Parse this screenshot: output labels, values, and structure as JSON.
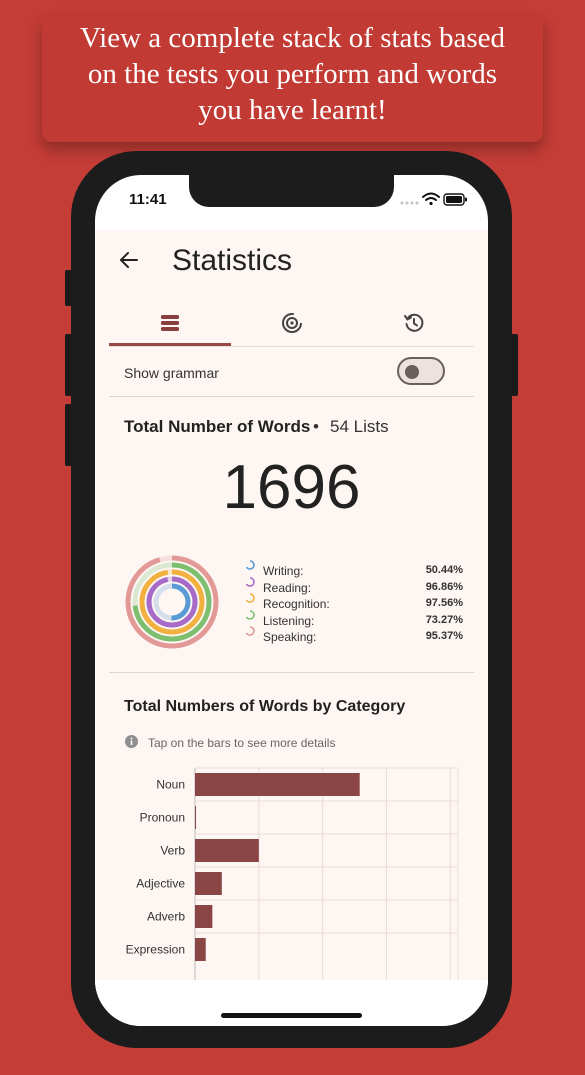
{
  "banner": {
    "line1": "View a complete stack of stats based",
    "line2": "on the tests you perform and words",
    "line3": "you have learnt!"
  },
  "status_bar": {
    "time": "11:41",
    "icons": [
      "wifi-icon",
      "battery-icon"
    ]
  },
  "header": {
    "title": "Statistics",
    "back_icon": "arrow-left-icon"
  },
  "tabs": [
    {
      "icon": "list-icon",
      "selected": true
    },
    {
      "icon": "radar-icon",
      "selected": false
    },
    {
      "icon": "history-icon",
      "selected": false
    }
  ],
  "grammar_toggle": {
    "label": "Show grammar",
    "on": false
  },
  "summary": {
    "title": "Total Number of Words",
    "separator": "•",
    "lists": "54 Lists",
    "total": "1696"
  },
  "skills": [
    {
      "label": "Writing:",
      "percent_text": "50.44%",
      "value": 50.44,
      "color": "#5b9bd5"
    },
    {
      "label": "Reading:",
      "percent_text": "96.86%",
      "value": 96.86,
      "color": "#a66bc7"
    },
    {
      "label": "Recognition:",
      "percent_text": "97.56%",
      "value": 97.56,
      "color": "#f2b13e"
    },
    {
      "label": "Listening:",
      "percent_text": "73.27%",
      "value": 73.27,
      "color": "#7dbf6e"
    },
    {
      "label": "Speaking:",
      "percent_text": "95.37%",
      "value": 95.37,
      "color": "#e39a96"
    }
  ],
  "category_section": {
    "title": "Total Numbers of Words by Category",
    "hint": "Tap on the bars to see more details",
    "info_icon": "info-icon"
  },
  "chart_data": {
    "type": "bar",
    "orientation": "horizontal",
    "categories": [
      "Noun",
      "Pronoun",
      "Verb",
      "Adjective",
      "Adverb",
      "Expression"
    ],
    "values": [
      645,
      4,
      250,
      105,
      68,
      42
    ],
    "xlim": [
      0,
      1030
    ],
    "grid": true,
    "bar_color": "#8a4545"
  }
}
